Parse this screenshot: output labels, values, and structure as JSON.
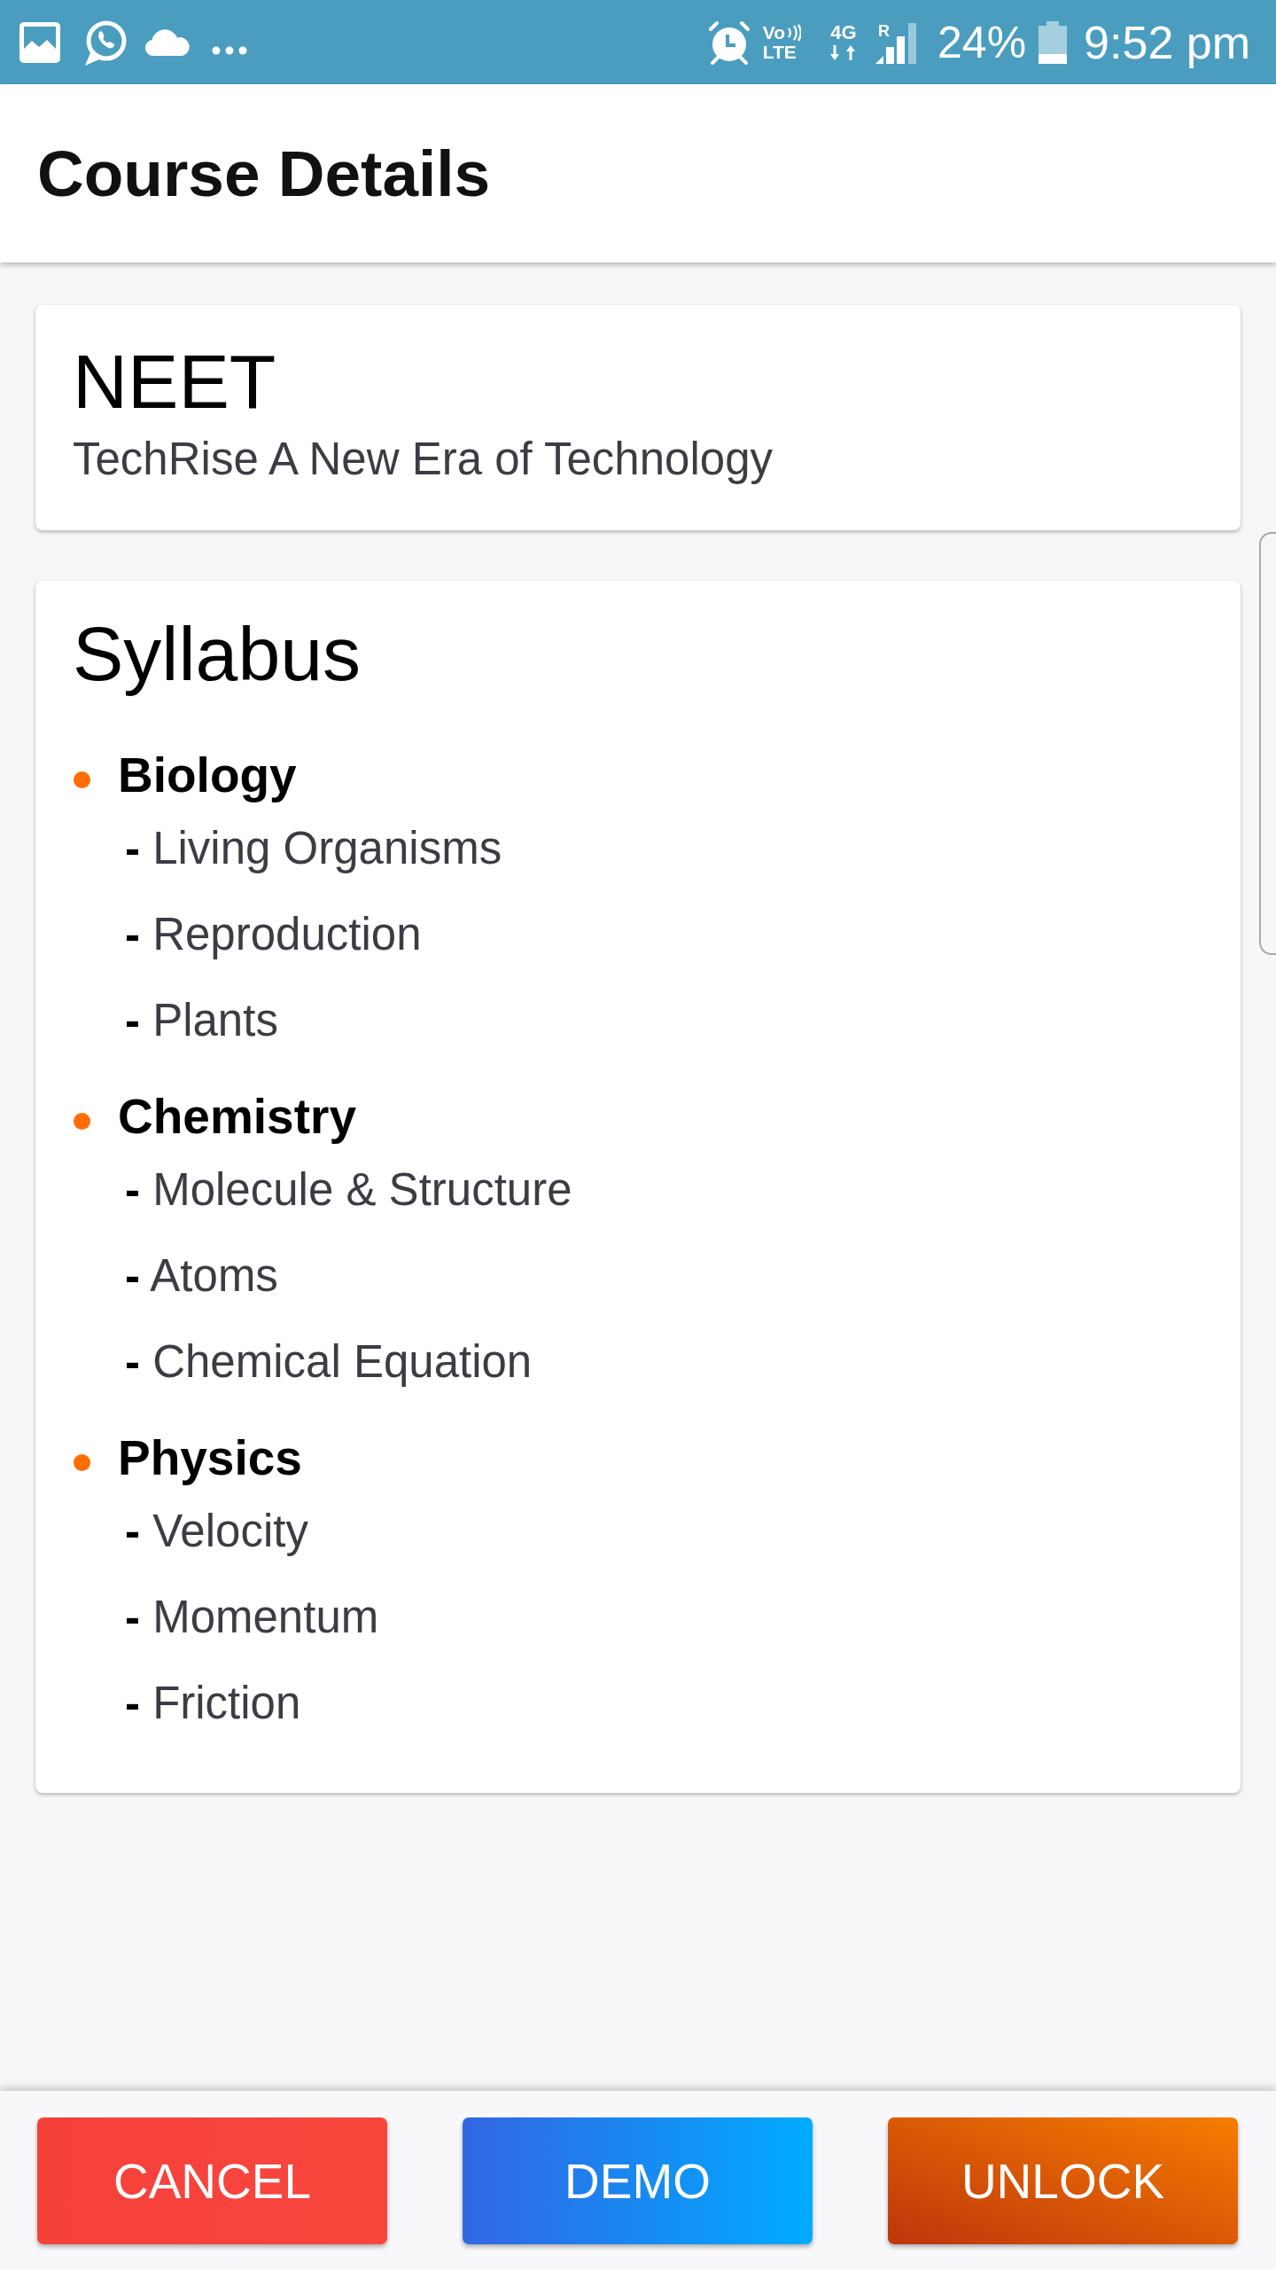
{
  "status_bar": {
    "volte_top": "Vo",
    "volte_bottom": "LTE",
    "network": "4G",
    "roaming": "R",
    "battery": "24%",
    "time": "9:52 pm"
  },
  "app_bar": {
    "title": "Course Details"
  },
  "course_card": {
    "name": "NEET",
    "provider": "TechRise A New Era of Technology"
  },
  "syllabus_card": {
    "title": "Syllabus",
    "subjects": [
      {
        "name": "Biology",
        "topics": [
          "**-** Living Organisms",
          "**-** Reproduction",
          "**-** Plants"
        ]
      },
      {
        "name": "Chemistry",
        "topics": [
          "**-** Molecule & Structure",
          "**-** Atoms",
          "**-** Chemical Equation"
        ]
      },
      {
        "name": "Physics",
        "topics": [
          "**-** Velocity",
          "**-** Momentum",
          "**-** Friction"
        ]
      }
    ]
  },
  "buttons": [
    {
      "label": "CANCEL",
      "kind": "cancel"
    },
    {
      "label": "DEMO",
      "kind": "demo"
    },
    {
      "label": "UNLOCK",
      "kind": "unlock"
    }
  ]
}
